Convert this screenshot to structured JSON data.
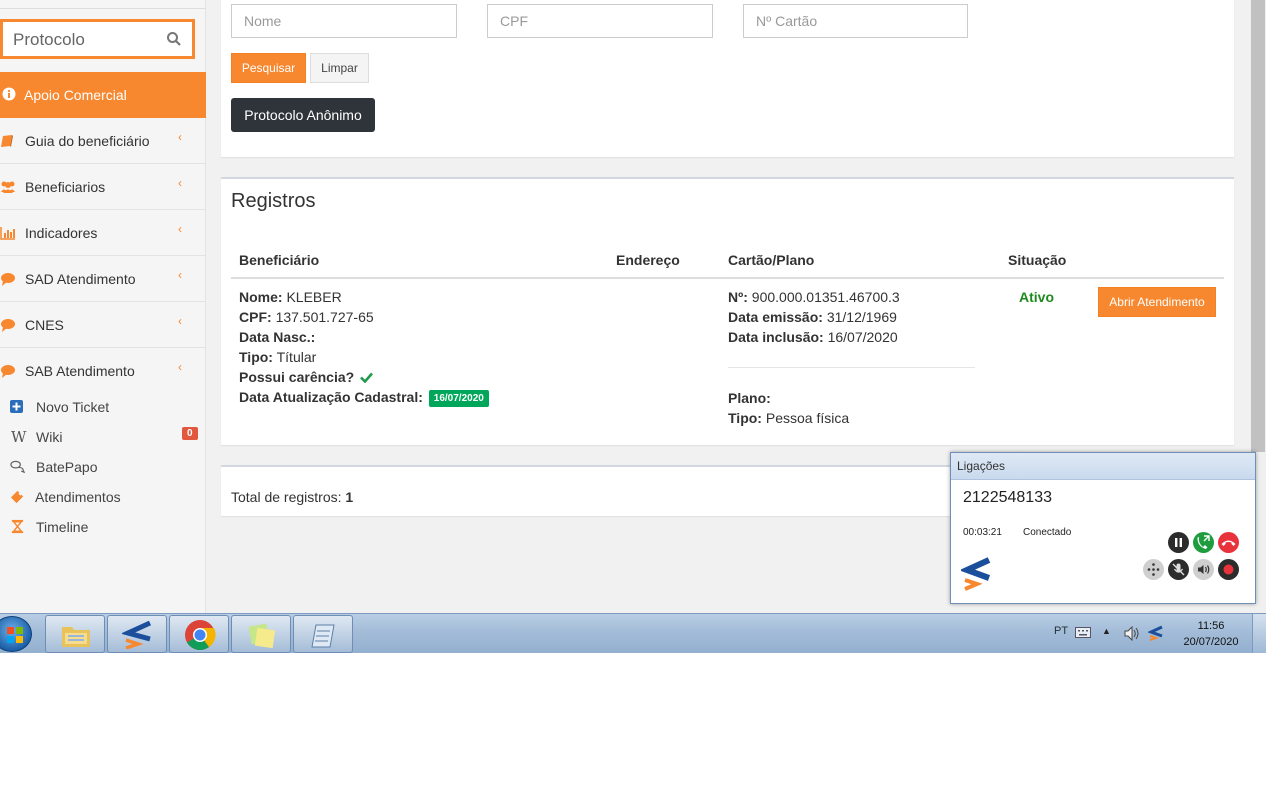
{
  "sidebar": {
    "search_placeholder": "Protocolo",
    "menu": [
      {
        "label": "Apoio Comercial",
        "icon": "info-icon",
        "active": true
      },
      {
        "label": "Guia do beneficiário",
        "icon": "book-icon"
      },
      {
        "label": "Beneficiarios",
        "icon": "users-icon"
      },
      {
        "label": "Indicadores",
        "icon": "bar-chart-icon"
      },
      {
        "label": "SAD Atendimento",
        "icon": "chat-icon"
      },
      {
        "label": "CNES",
        "icon": "chat-icon"
      },
      {
        "label": "SAB Atendimento",
        "icon": "chat-icon"
      }
    ],
    "submenu": [
      {
        "label": "Novo Ticket",
        "icon": "plus-square-icon"
      },
      {
        "label": "Wiki",
        "icon": "wiki-icon",
        "badge": "0"
      },
      {
        "label": "BatePapo",
        "icon": "chat-bubbles-icon"
      },
      {
        "label": "Atendimentos",
        "icon": "ticket-icon"
      },
      {
        "label": "Timeline",
        "icon": "hourglass-icon"
      }
    ]
  },
  "search_form": {
    "nome_placeholder": "Nome",
    "cpf_placeholder": "CPF",
    "cartao_placeholder": "Nº Cartão",
    "search_label": "Pesquisar",
    "clear_label": "Limpar",
    "anon_label": "Protocolo Anônimo"
  },
  "registros": {
    "title": "Registros",
    "columns": [
      "Beneficiário",
      "Endereço",
      "Cartão/Plano",
      "Situação"
    ],
    "row": {
      "nome_label": "Nome:",
      "nome": "KLEBER",
      "cpf_label": "CPF:",
      "cpf": "137.501.727-65",
      "nasc_label": "Data Nasc.:",
      "tipo_label": "Tipo:",
      "tipo": "Títular",
      "carencia_label": "Possui carência?",
      "atualizacao_label": "Data Atualização Cadastral:",
      "atualizacao": "16/07/2020",
      "numero_label": "Nº:",
      "numero": "900.000.01351.46700.3",
      "emissao_label": "Data emissão:",
      "emissao": "31/12/1969",
      "inclusao_label": "Data inclusão:",
      "inclusao": "16/07/2020",
      "plano_label": "Plano:",
      "plano_tipo_label": "Tipo:",
      "plano_tipo": "Pessoa física",
      "situacao": "Ativo",
      "action_label": "Abrir Atendimento"
    }
  },
  "footer": {
    "total_label": "Total de registros:",
    "total": "1"
  },
  "phone": {
    "title": "Ligações",
    "number": "2122548133",
    "duration": "00:03:21",
    "status": "Conectado"
  },
  "taskbar": {
    "lang": "PT",
    "time": "11:56",
    "date": "20/07/2020"
  },
  "colors": {
    "accent": "#f7882f",
    "active_green": "#1e8a1e",
    "badge_green": "#00a65a",
    "dark_button": "#2e343a"
  }
}
